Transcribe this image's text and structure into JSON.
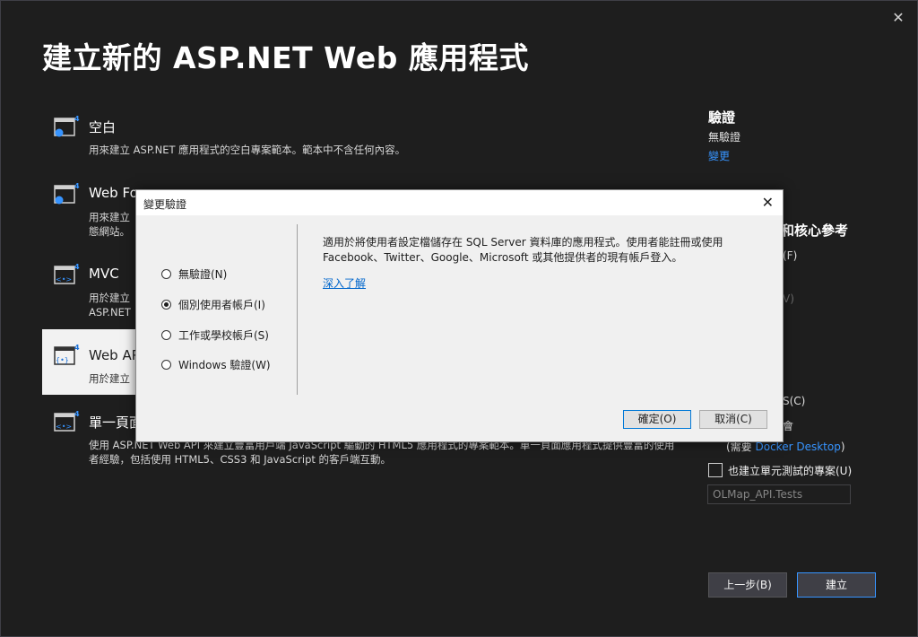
{
  "window": {
    "title": "建立新的 ASP.NET Web 應用程式"
  },
  "templates": [
    {
      "name": "空白",
      "desc": "用來建立 ASP.NET 應用程式的空白專案範本。範本中不含任何內容。",
      "icon": "project-empty-icon"
    },
    {
      "name": "Web Fo",
      "desc": "用來建立\n態網站。",
      "icon": "project-webforms-icon"
    },
    {
      "name": "MVC",
      "desc": "用於建立\nASP.NET",
      "icon": "project-mvc-icon"
    },
    {
      "name": "Web AP",
      "desc": "用於建立",
      "icon": "project-webapi-icon",
      "selected": true
    },
    {
      "name": "單一頁面",
      "desc": "使用 ASP.NET Web API 來建立豐富用戶端 JavaScript 驅動的 HTML5 應用程式的專案範本。單一頁面應用程式提供豐富的使用者經驗，包括使用 HTML5、CSS3 和 JavaScript 的客戶端互動。",
      "icon": "project-spa-icon"
    }
  ],
  "side": {
    "auth_heading": "驗證",
    "auth_value": "無驗證",
    "auth_change_link": "變更",
    "ref_heading": "和核心參考",
    "ref_f": "(F)",
    "ref_v": "V)",
    "ref_c": "S(C)",
    "ref_c2": "會",
    "docker_prefix": "(需要 ",
    "docker_link": "Docker Desktop",
    "docker_suffix": ")",
    "unit_test_label": "也建立單元測試的專案(U)",
    "unit_test_name": "OLMap_API.Tests"
  },
  "buttons": {
    "back": "上一步(B)",
    "create": "建立"
  },
  "dialog": {
    "title": "變更驗證",
    "options": [
      {
        "label": "無驗證(N)",
        "checked": false
      },
      {
        "label": "個別使用者帳戶(I)",
        "checked": true
      },
      {
        "label": "工作或學校帳戶(S)",
        "checked": false
      },
      {
        "label": "Windows 驗證(W)",
        "checked": false
      }
    ],
    "description": "適用於將使用者設定檔儲存在 SQL Server 資料庫的應用程式。使用者能註冊或使用 Facebook、Twitter、Google、Microsoft 或其他提供者的現有帳戶登入。",
    "learn_more": "深入了解",
    "ok": "確定(O)",
    "cancel": "取消(C)"
  },
  "colors": {
    "background": "#1e1e1e",
    "accent": "#3794ff",
    "dialog_bg": "#f0f0f0"
  }
}
